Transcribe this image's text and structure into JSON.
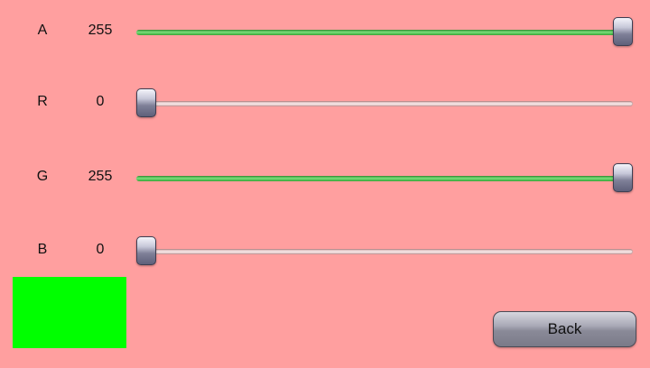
{
  "colors": {
    "background": "#ff9f9f",
    "slider_fill": "#4cbb4c",
    "preview": "#00ff00"
  },
  "slider_range": {
    "min": 0,
    "max": 255
  },
  "channels": [
    {
      "label": "A",
      "value": "255"
    },
    {
      "label": "R",
      "value": "0"
    },
    {
      "label": "G",
      "value": "255"
    },
    {
      "label": "B",
      "value": "0"
    }
  ],
  "back_label": "Back"
}
